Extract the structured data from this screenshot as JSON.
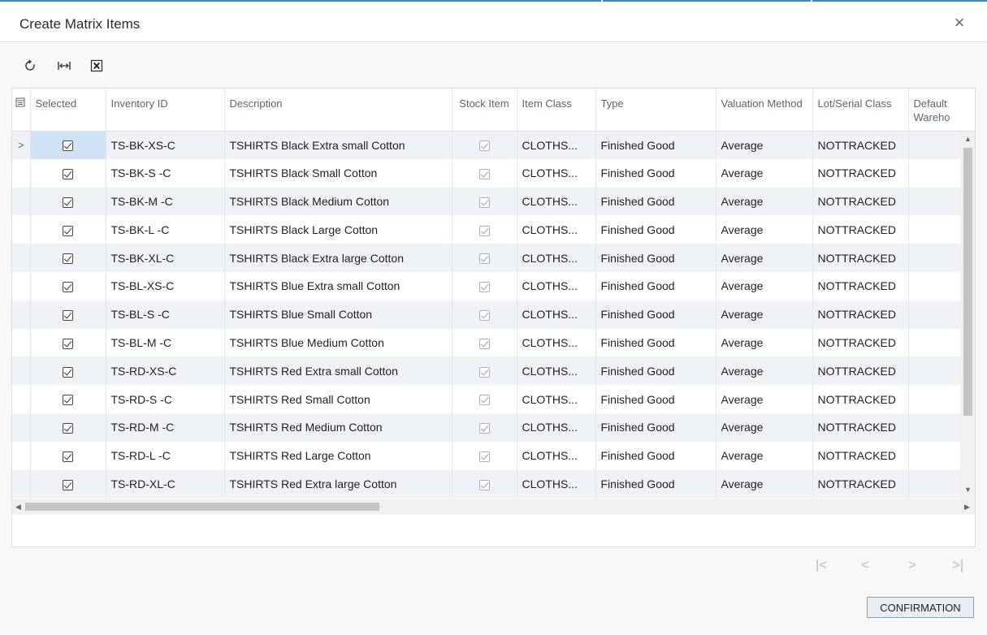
{
  "dialog": {
    "title": "Create Matrix Items",
    "close_glyph": "×"
  },
  "toolbar": {
    "refresh_icon": "refresh-icon",
    "fit_icon": "fit-to-screen-icon",
    "excel_icon": "export-excel-icon"
  },
  "grid": {
    "columns": [
      {
        "key": "selected",
        "label": "Selected"
      },
      {
        "key": "inventory_id",
        "label": "Inventory ID"
      },
      {
        "key": "description",
        "label": "Description"
      },
      {
        "key": "stock_item",
        "label": "Stock Item"
      },
      {
        "key": "item_class",
        "label": "Item Class"
      },
      {
        "key": "type",
        "label": "Type"
      },
      {
        "key": "valuation_method",
        "label": "Valuation Method"
      },
      {
        "key": "lot_serial_class",
        "label": "Lot/Serial Class"
      },
      {
        "key": "default_warehouse",
        "label": "Default Wareho"
      }
    ],
    "rows": [
      {
        "selected": true,
        "inventory_id": "TS-BK-XS-C",
        "description": "TSHIRTS Black Extra small Cotton",
        "stock_item": true,
        "item_class": "CLOTHS...",
        "type": "Finished Good",
        "valuation_method": "Average",
        "lot_serial_class": "NOTTRACKED",
        "default_warehouse": ""
      },
      {
        "selected": true,
        "inventory_id": "TS-BK-S -C",
        "description": "TSHIRTS Black Small Cotton",
        "stock_item": true,
        "item_class": "CLOTHS...",
        "type": "Finished Good",
        "valuation_method": "Average",
        "lot_serial_class": "NOTTRACKED",
        "default_warehouse": ""
      },
      {
        "selected": true,
        "inventory_id": "TS-BK-M -C",
        "description": "TSHIRTS Black Medium Cotton",
        "stock_item": true,
        "item_class": "CLOTHS...",
        "type": "Finished Good",
        "valuation_method": "Average",
        "lot_serial_class": "NOTTRACKED",
        "default_warehouse": ""
      },
      {
        "selected": true,
        "inventory_id": "TS-BK-L -C",
        "description": "TSHIRTS Black Large Cotton",
        "stock_item": true,
        "item_class": "CLOTHS...",
        "type": "Finished Good",
        "valuation_method": "Average",
        "lot_serial_class": "NOTTRACKED",
        "default_warehouse": ""
      },
      {
        "selected": true,
        "inventory_id": "TS-BK-XL-C",
        "description": "TSHIRTS Black Extra large Cotton",
        "stock_item": true,
        "item_class": "CLOTHS...",
        "type": "Finished Good",
        "valuation_method": "Average",
        "lot_serial_class": "NOTTRACKED",
        "default_warehouse": ""
      },
      {
        "selected": true,
        "inventory_id": "TS-BL-XS-C",
        "description": "TSHIRTS Blue Extra small Cotton",
        "stock_item": true,
        "item_class": "CLOTHS...",
        "type": "Finished Good",
        "valuation_method": "Average",
        "lot_serial_class": "NOTTRACKED",
        "default_warehouse": ""
      },
      {
        "selected": true,
        "inventory_id": "TS-BL-S -C",
        "description": "TSHIRTS Blue Small Cotton",
        "stock_item": true,
        "item_class": "CLOTHS...",
        "type": "Finished Good",
        "valuation_method": "Average",
        "lot_serial_class": "NOTTRACKED",
        "default_warehouse": ""
      },
      {
        "selected": true,
        "inventory_id": "TS-BL-M -C",
        "description": "TSHIRTS Blue Medium Cotton",
        "stock_item": true,
        "item_class": "CLOTHS...",
        "type": "Finished Good",
        "valuation_method": "Average",
        "lot_serial_class": "NOTTRACKED",
        "default_warehouse": ""
      },
      {
        "selected": true,
        "inventory_id": "TS-RD-XS-C",
        "description": "TSHIRTS Red Extra small Cotton",
        "stock_item": true,
        "item_class": "CLOTHS...",
        "type": "Finished Good",
        "valuation_method": "Average",
        "lot_serial_class": "NOTTRACKED",
        "default_warehouse": ""
      },
      {
        "selected": true,
        "inventory_id": "TS-RD-S -C",
        "description": "TSHIRTS Red Small Cotton",
        "stock_item": true,
        "item_class": "CLOTHS...",
        "type": "Finished Good",
        "valuation_method": "Average",
        "lot_serial_class": "NOTTRACKED",
        "default_warehouse": ""
      },
      {
        "selected": true,
        "inventory_id": "TS-RD-M -C",
        "description": "TSHIRTS Red Medium Cotton",
        "stock_item": true,
        "item_class": "CLOTHS...",
        "type": "Finished Good",
        "valuation_method": "Average",
        "lot_serial_class": "NOTTRACKED",
        "default_warehouse": ""
      },
      {
        "selected": true,
        "inventory_id": "TS-RD-L -C",
        "description": "TSHIRTS Red Large Cotton",
        "stock_item": true,
        "item_class": "CLOTHS...",
        "type": "Finished Good",
        "valuation_method": "Average",
        "lot_serial_class": "NOTTRACKED",
        "default_warehouse": ""
      },
      {
        "selected": true,
        "inventory_id": "TS-RD-XL-C",
        "description": "TSHIRTS Red Extra large Cotton",
        "stock_item": true,
        "item_class": "CLOTHS...",
        "type": "Finished Good",
        "valuation_method": "Average",
        "lot_serial_class": "NOTTRACKED",
        "default_warehouse": ""
      }
    ],
    "active_row_indicator": ">"
  },
  "pager": {
    "first": "|<",
    "prev": "<",
    "next": ">",
    "last": ">|"
  },
  "footer": {
    "confirm_label": "CONFIRMATION"
  },
  "colors": {
    "accent": "#3b87c6",
    "row_alt": "#eff2f7",
    "selected_cell": "#cfe3f5"
  }
}
